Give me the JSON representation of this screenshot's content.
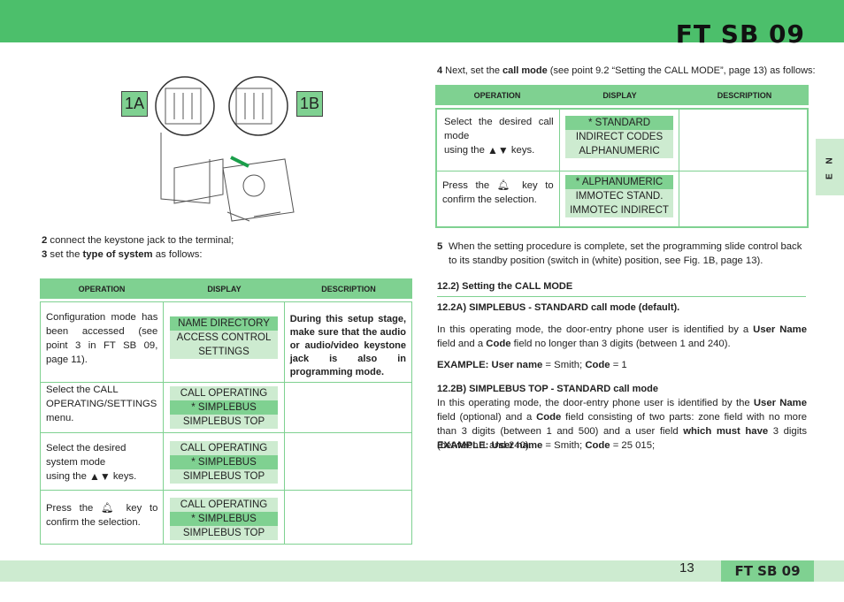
{
  "header": {
    "title": "FT SB 09",
    "color": "#4cbf6b"
  },
  "side_tab": "E N",
  "figure": {
    "label_a": "1A",
    "label_b": "1B"
  },
  "left": {
    "step2": {
      "num": "2",
      "text": " connect the keystone jack to the terminal;"
    },
    "step3": {
      "num": "3",
      "t1": " set the ",
      "b1": "type of system",
      "t2": " as follows:"
    },
    "table": {
      "headers": [
        "OPERATION",
        "DISPLAY",
        "DESCRIPTION"
      ],
      "rows": [
        {
          "operation": "Configuration mode has been accessed (see point 3 in FT SB 09, page 11).",
          "display": [
            "NAME DIRECTORY",
            "ACCESS CONTROL",
            "SETTINGS"
          ],
          "highlight": 0,
          "description": "During this setup stage, make sure that the audio or audio/video keystone jack is also in programming mode."
        },
        {
          "operation": "Select the CALL OPERATING/SETTINGS menu.",
          "display": [
            "CALL OPERATING",
            "* SIMPLEBUS",
            "SIMPLEBUS TOP"
          ],
          "highlight": 1,
          "description": ""
        },
        {
          "operation_a": "Select the desired system mode",
          "operation_b": "using the",
          "operation_c": "keys.",
          "display": [
            "CALL OPERATING",
            "* SIMPLEBUS",
            "SIMPLEBUS TOP"
          ],
          "highlight": 1,
          "description": ""
        },
        {
          "operation_a": "Press the",
          "operation_b": "key to confirm the selection.",
          "display": [
            "CALL OPERATING",
            "* SIMPLEBUS",
            "SIMPLEBUS TOP"
          ],
          "highlight": 1,
          "description": ""
        }
      ]
    }
  },
  "right": {
    "step4": {
      "num": "4",
      "t1": " Next, set the ",
      "b1": "call mode",
      "t2": " (see point 9.2 “Setting the CALL MODE”, page 13) as follows:"
    },
    "table": {
      "headers": [
        "OPERATION",
        "DISPLAY",
        "DESCRIPTION"
      ],
      "rows": [
        {
          "operation_a": "Select the desired call mode",
          "operation_b": "using the",
          "operation_c": "keys.",
          "display": [
            "* STANDARD",
            "INDIRECT CODES",
            "ALPHANUMERIC"
          ],
          "highlight": 0,
          "description": ""
        },
        {
          "operation_a": "Press the",
          "operation_b": "key to confirm the selection.",
          "display": [
            "* ALPHANUMERIC",
            "IMMOTEC STAND.",
            "IMMOTEC INDIRECT"
          ],
          "highlight": 0,
          "description": ""
        }
      ]
    },
    "step5": {
      "num": "5",
      "text": "When the setting procedure is complete, set the programming slide control back to its standby position (switch in (white) position, see Fig. 1B, page 13)."
    },
    "section_title": "12.2) Setting the CALL MODE",
    "sub_a": {
      "title": "12.2A) SIMPLEBUS - STANDARD call mode (default).",
      "p": [
        "In this operating mode, the door-entry phone user is identified by a ",
        "User Name",
        " field and a ",
        "Code",
        " field no longer than 3 digits (between 1 and 240)."
      ],
      "example": [
        "EXAMPLE:  User name",
        " = Smith; ",
        "Code",
        " = 1"
      ]
    },
    "sub_b": {
      "title": "12.2B) SIMPLEBUS TOP - STANDARD call mode",
      "p": [
        "In this operating mode, the door-entry phone user is identified by the ",
        "User Name",
        " field (optional)  and  a ",
        "Code",
        " field consisting of two parts: zone field with no more than 3 digits (between 1 and 500) and a user field ",
        "which must have",
        " 3 digits (between 1 and 240)."
      ],
      "example": [
        "EXAMPLE:  User name",
        " = Smith; ",
        "Code",
        " = 25 015;"
      ]
    }
  },
  "footer": {
    "page": "13",
    "title": "FT SB 09",
    "color": "#7fd191"
  }
}
